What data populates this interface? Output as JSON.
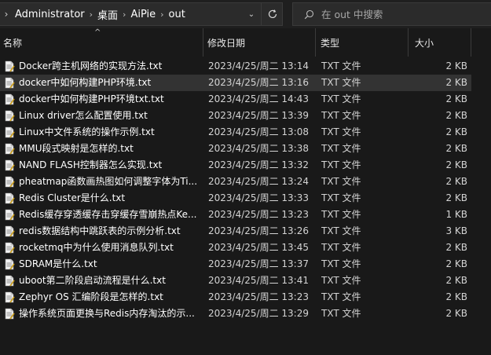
{
  "address_bar": {
    "breadcrumbs": [
      "Administrator",
      "桌面",
      "AiPie",
      "out"
    ]
  },
  "search": {
    "placeholder": "在 out 中搜索"
  },
  "columns": {
    "name": "名称",
    "date": "修改日期",
    "type": "类型",
    "size": "大小"
  },
  "files": [
    {
      "name": "Docker跨主机网络的实现方法.txt",
      "date": "2023/4/25/周二 13:14",
      "type": "TXT 文件",
      "size": "2 KB"
    },
    {
      "name": "docker中如何构建PHP环境.txt",
      "date": "2023/4/25/周二 13:16",
      "type": "TXT 文件",
      "size": "2 KB"
    },
    {
      "name": "docker中如何构建PHP环境txt.txt",
      "date": "2023/4/25/周二 14:43",
      "type": "TXT 文件",
      "size": "2 KB"
    },
    {
      "name": "Linux driver怎么配置使用.txt",
      "date": "2023/4/25/周二 13:39",
      "type": "TXT 文件",
      "size": "2 KB"
    },
    {
      "name": "Linux中文件系统的操作示例.txt",
      "date": "2023/4/25/周二 13:08",
      "type": "TXT 文件",
      "size": "2 KB"
    },
    {
      "name": "MMU段式映射是怎样的.txt",
      "date": "2023/4/25/周二 13:38",
      "type": "TXT 文件",
      "size": "2 KB"
    },
    {
      "name": "NAND FLASH控制器怎么实现.txt",
      "date": "2023/4/25/周二 13:32",
      "type": "TXT 文件",
      "size": "2 KB"
    },
    {
      "name": "pheatmap函数画热图如何调整字体为Ti...",
      "date": "2023/4/25/周二 13:24",
      "type": "TXT 文件",
      "size": "2 KB"
    },
    {
      "name": "Redis Cluster是什么.txt",
      "date": "2023/4/25/周二 13:33",
      "type": "TXT 文件",
      "size": "2 KB"
    },
    {
      "name": "Redis缓存穿透缓存击穿缓存雪崩热点Ke...",
      "date": "2023/4/25/周二 13:23",
      "type": "TXT 文件",
      "size": "1 KB"
    },
    {
      "name": "redis数据结构中跳跃表的示例分析.txt",
      "date": "2023/4/25/周二 13:26",
      "type": "TXT 文件",
      "size": "3 KB"
    },
    {
      "name": "rocketmq中为什么使用消息队列.txt",
      "date": "2023/4/25/周二 13:45",
      "type": "TXT 文件",
      "size": "2 KB"
    },
    {
      "name": "SDRAM是什么.txt",
      "date": "2023/4/25/周二 13:37",
      "type": "TXT 文件",
      "size": "2 KB"
    },
    {
      "name": "uboot第二阶段启动流程是什么.txt",
      "date": "2023/4/25/周二 13:41",
      "type": "TXT 文件",
      "size": "2 KB"
    },
    {
      "name": "Zephyr OS 汇编阶段是怎样的.txt",
      "date": "2023/4/25/周二 13:23",
      "type": "TXT 文件",
      "size": "2 KB"
    },
    {
      "name": "操作系统页面更换与Redis内存淘汰的示...",
      "date": "2023/4/25/周二 13:29",
      "type": "TXT 文件",
      "size": "2 KB"
    }
  ],
  "hovered_row": 1,
  "colors": {
    "background": "#191919",
    "hover": "#333333",
    "text": "#ffffff",
    "subtext": "#d4d4d4"
  }
}
